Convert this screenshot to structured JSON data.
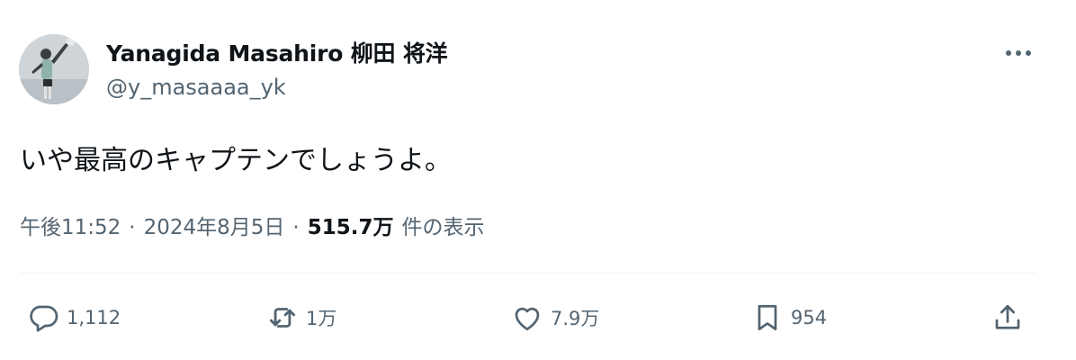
{
  "user": {
    "display_name": "Yanagida Masahiro 柳田 将洋",
    "handle": "@y_masaaaa_yk"
  },
  "tweet": {
    "text": "いや最高のキャプテンでしょうよ。",
    "time": "午後11:52",
    "separator": "·",
    "date": "2024年8月5日",
    "views_count": "515.7万",
    "views_label": "件の表示"
  },
  "actions": {
    "reply": {
      "icon": "reply-icon",
      "count": "1,112"
    },
    "repost": {
      "icon": "repost-icon",
      "count": "1万"
    },
    "like": {
      "icon": "heart-icon",
      "count": "7.9万"
    },
    "bookmark": {
      "icon": "bookmark-icon",
      "count": "954"
    },
    "share": {
      "icon": "share-icon"
    }
  },
  "colors": {
    "text_primary": "#0f1419",
    "text_secondary": "#536471",
    "divider": "#eff3f4"
  }
}
